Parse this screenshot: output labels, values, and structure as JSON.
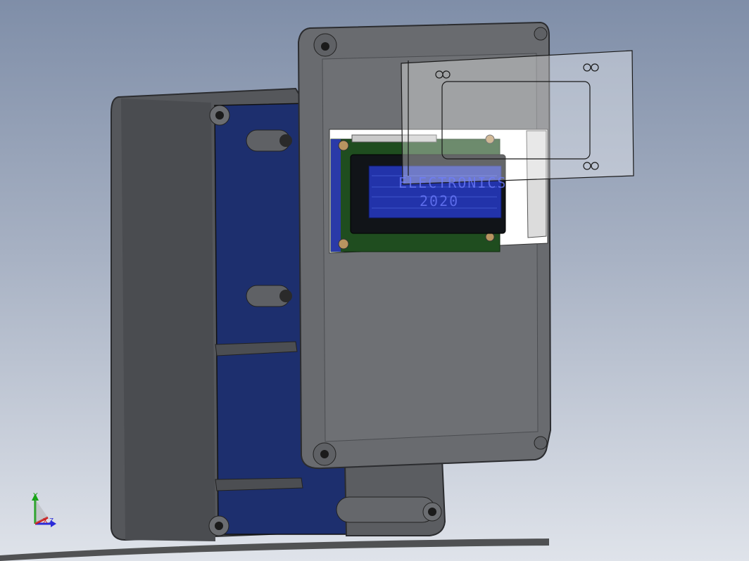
{
  "viewport": {
    "lcd": {
      "line1": "ELECTRONICS",
      "line2": "2020"
    },
    "triad": {
      "x_label": "X",
      "y_label": "Y",
      "z_label": "Z",
      "x_color": "#d11a1a",
      "y_color": "#17a317",
      "z_color": "#2a2ad8"
    }
  },
  "colors": {
    "enclosure": "#5d5f63",
    "enclosure_dark": "#3d3f43",
    "interior": "#1d2f6e",
    "pcb": "#1f4d1f",
    "lcd_bezel": "#111418",
    "lcd_screen": "#2233aa",
    "lid": "#6a6c70"
  }
}
